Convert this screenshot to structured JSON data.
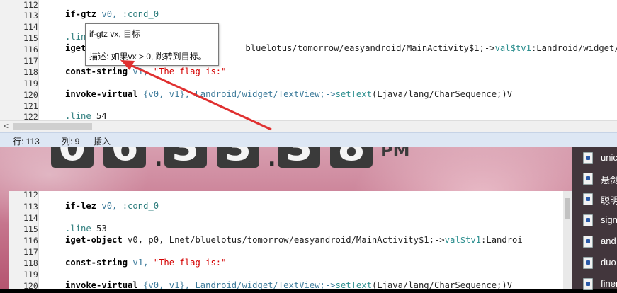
{
  "desktop": {
    "clock": {
      "digits": [
        "0",
        "6",
        "3",
        "3",
        "3",
        "8"
      ],
      "ampm": "PM"
    },
    "file_list": [
      {
        "name": "unic",
        "icon": "document-icon"
      },
      {
        "name": "悬剑",
        "icon": "document-icon"
      },
      {
        "name": "聪明",
        "icon": "document-icon"
      },
      {
        "name": "sign",
        "icon": "image-icon"
      },
      {
        "name": "and",
        "icon": "document-icon"
      },
      {
        "name": "duo",
        "icon": "document-icon"
      },
      {
        "name": "finer",
        "icon": "document-icon"
      }
    ]
  },
  "editor_top": {
    "line_numbers": [
      "112",
      "113",
      "114",
      "115",
      "116",
      "117",
      "118",
      "119",
      "120",
      "121",
      "122"
    ],
    "lines": {
      "l113": {
        "kw": "if-gtz",
        "args": " v0, ",
        "label": ":cond_0"
      },
      "l115": {
        "directive": ".lin"
      },
      "l116": {
        "kw": "iget",
        "rest": "bluelotus/tomorrow/easyandroid/MainActivity$1;->",
        "field": "val$tv1",
        "tail": ":Landroid/widget/T"
      },
      "l118": {
        "kw": "const-string",
        "args": " v1, ",
        "str": "\"The flag is:\""
      },
      "l120": {
        "kw": "invoke-virtual",
        "args": " {v0, v1}, Landroid/widget/TextView;->",
        "method": "setText",
        "tail": "(Ljava/lang/CharSequence;)V"
      },
      "l122": {
        "directive": ".line",
        "num": " 54"
      }
    },
    "status": {
      "row": "行: 113",
      "col": "列: 9",
      "mode": "插入"
    }
  },
  "tooltip": {
    "title": "if-gtz vx, 目标",
    "desc": "描述: 如果vx > 0, 跳转到目标。"
  },
  "editor_bottom": {
    "line_numbers": [
      "112",
      "113",
      "114",
      "115",
      "116",
      "117",
      "118",
      "119",
      "120"
    ],
    "lines": {
      "l113": {
        "kw": "if-lez",
        "args": " v0, ",
        "label": ":cond_0"
      },
      "l115": {
        "directive": ".line",
        "num": " 53"
      },
      "l116": {
        "kw": "iget-object",
        "args": " v0, p0, Lnet/bluelotus/tomorrow/easyandroid/MainActivity$1;->",
        "field": "val$tv1",
        "tail": ":Landroi"
      },
      "l118": {
        "kw": "const-string",
        "args": " v1, ",
        "str": "\"The flag is:\""
      },
      "l120": {
        "kw": "invoke-virtual",
        "args": " {v0, v1}, Landroid/widget/TextView;->",
        "method": "setText",
        "tail": "(Ljava/lang/CharSequence;)V"
      }
    }
  },
  "colors": {
    "arrow": "#e03030",
    "status_bg": "#dde7f4",
    "string": "#d40000"
  }
}
